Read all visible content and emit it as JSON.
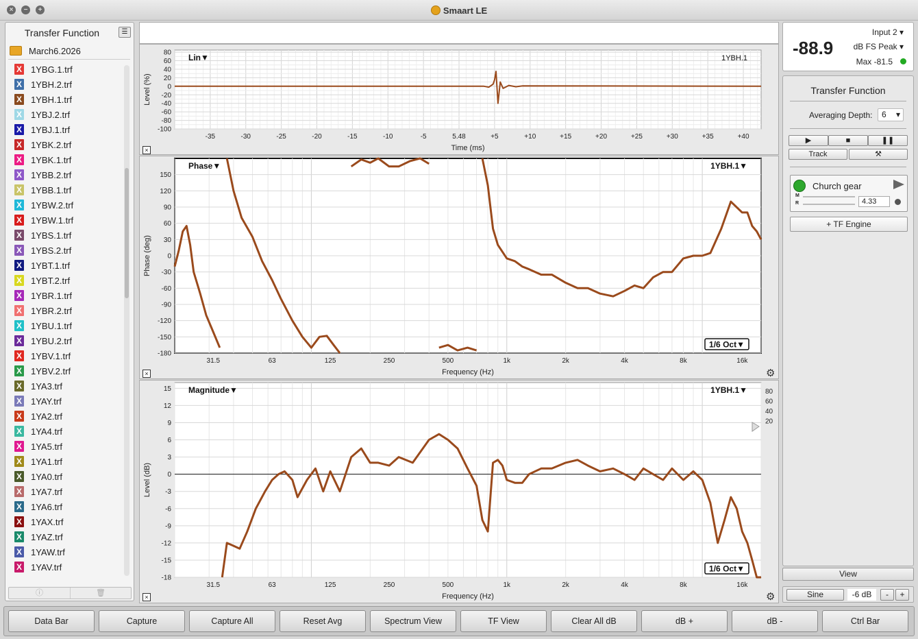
{
  "window": {
    "title": "Smaart LE"
  },
  "sidebar": {
    "title": "Transfer Function",
    "folder": "March6.2026",
    "files": [
      {
        "name": "1YBG.1.trf",
        "color": "#e53935"
      },
      {
        "name": "1YBH.2.trf",
        "color": "#3f6fa8"
      },
      {
        "name": "1YBH.1.trf",
        "color": "#8a4a1e"
      },
      {
        "name": "1YBJ.2.trf",
        "color": "#9fd8e6"
      },
      {
        "name": "1YBJ.1.trf",
        "color": "#1a1aa8"
      },
      {
        "name": "1YBK.2.trf",
        "color": "#c62828"
      },
      {
        "name": "1YBK.1.trf",
        "color": "#ec1c84"
      },
      {
        "name": "1YBB.2.trf",
        "color": "#8e58c8"
      },
      {
        "name": "1YBB.1.trf",
        "color": "#c9c468"
      },
      {
        "name": "1YBW.2.trf",
        "color": "#1fb8d8"
      },
      {
        "name": "1YBW.1.trf",
        "color": "#d81c1c"
      },
      {
        "name": "1YBS.1.trf",
        "color": "#7a4a6a"
      },
      {
        "name": "1YBS.2.trf",
        "color": "#8a58b8"
      },
      {
        "name": "1YBT.1.trf",
        "color": "#101a80"
      },
      {
        "name": "1YBT.2.trf",
        "color": "#d8d820"
      },
      {
        "name": "1YBR.1.trf",
        "color": "#a628b8"
      },
      {
        "name": "1YBR.2.trf",
        "color": "#f07070"
      },
      {
        "name": "1YBU.1.trf",
        "color": "#20c0c8"
      },
      {
        "name": "1YBU.2.trf",
        "color": "#6a2a9a"
      },
      {
        "name": "1YBV.1.trf",
        "color": "#e02820"
      },
      {
        "name": "1YBV.2.trf",
        "color": "#2a9a4a"
      },
      {
        "name": "1YA3.trf",
        "color": "#6a6a2a"
      },
      {
        "name": "1YAY.trf",
        "color": "#7a7ab8"
      },
      {
        "name": "1YA2.trf",
        "color": "#c83a1a"
      },
      {
        "name": "1YA4.trf",
        "color": "#3ab8a0"
      },
      {
        "name": "1YA5.trf",
        "color": "#e01890"
      },
      {
        "name": "1YA1.trf",
        "color": "#a08a1a"
      },
      {
        "name": "1YA0.trf",
        "color": "#4a5a2a"
      },
      {
        "name": "1YA7.trf",
        "color": "#b86a6a"
      },
      {
        "name": "1YA6.trf",
        "color": "#2a6a8a"
      },
      {
        "name": "1YAX.trf",
        "color": "#8a1010"
      },
      {
        "name": "1YAZ.trf",
        "color": "#1a8a6a"
      },
      {
        "name": "1YAW.trf",
        "color": "#4a5aa8"
      },
      {
        "name": "1YAV.trf",
        "color": "#c81a6a"
      }
    ]
  },
  "meter": {
    "value": "-88.9",
    "input": "Input 2",
    "unit": "dB FS Peak",
    "max": "Max -81.5"
  },
  "tf_panel": {
    "title": "Transfer Function",
    "avg_label": "Averaging Depth:",
    "avg_value": "6",
    "track_label": "Track",
    "engine_name": "Church gear",
    "engine_value": "4.33",
    "m_label": "M",
    "r_label": "R",
    "add_engine": "+ TF Engine"
  },
  "view_label": "View",
  "signal": {
    "type": "Sine",
    "level": "-6 dB",
    "minus": "-",
    "plus": "+"
  },
  "bottom_buttons": [
    "Data Bar",
    "Capture",
    "Capture All",
    "Reset Avg",
    "Spectrum View",
    "TF View",
    "Clear All dB",
    "dB +",
    "dB -",
    "Ctrl Bar"
  ],
  "chart_data": [
    {
      "type": "line",
      "title": "Lin▼",
      "trace_label": "1YBH.1",
      "xlabel": "Time (ms)",
      "ylabel": "Level (%)",
      "x_ticks": [
        "-35",
        "-30",
        "-25",
        "-20",
        "-15",
        "-10",
        "-5",
        "5.48",
        "+5",
        "+10",
        "+15",
        "+20",
        "+25",
        "+30",
        "+35",
        "+40"
      ],
      "y_ticks": [
        "80",
        "60",
        "40",
        "20",
        "0",
        "-20",
        "-40",
        "-60",
        "-80",
        "-100"
      ],
      "xlim": [
        -40,
        42.5
      ],
      "ylim": [
        -100,
        85
      ],
      "series": [
        {
          "color": "#9a4a1c",
          "x": [
            -40,
            3.5,
            4.2,
            4.8,
            5.0,
            5.2,
            5.48,
            5.8,
            6.2,
            7.0,
            8.0,
            9.0,
            42.5
          ],
          "y": [
            0,
            0,
            -2,
            5,
            15,
            35,
            -40,
            10,
            -5,
            2,
            -1,
            1,
            0
          ]
        }
      ]
    },
    {
      "type": "line",
      "title": "Phase▼",
      "trace_label": "1YBH.1▼",
      "smoothing": "1/6 Oct▼",
      "xlabel": "Frequency (Hz)",
      "ylabel": "Phase (deg)",
      "x_ticks": [
        "31.5",
        "63",
        "125",
        "250",
        "500",
        "1k",
        "2k",
        "4k",
        "8k",
        "16k"
      ],
      "y_ticks": [
        "150",
        "120",
        "90",
        "60",
        "30",
        "0",
        "-30",
        "-60",
        "-90",
        "-120",
        "-150",
        "-180"
      ],
      "xlim": [
        20,
        20000
      ],
      "ylim": [
        -180,
        180
      ],
      "series": [
        {
          "color": "#9a4a1c",
          "x": [
            20,
            21,
            22,
            23,
            24,
            25,
            27,
            29,
            31,
            34,
            37,
            40,
            44,
            50,
            56,
            63,
            70,
            80,
            90,
            100,
            110,
            120,
            130,
            140,
            160,
            180,
            200,
            220,
            250,
            280,
            320,
            360,
            400,
            450,
            500,
            560,
            630,
            700,
            750,
            800,
            850,
            900,
            1000,
            1100,
            1200,
            1300,
            1500,
            1700,
            2000,
            2300,
            2600,
            3000,
            3500,
            4000,
            4500,
            5000,
            5600,
            6300,
            7000,
            8000,
            9000,
            10000,
            11000,
            12500,
            14000,
            16000,
            17000,
            18000,
            19000,
            20000
          ],
          "y": [
            -20,
            10,
            45,
            55,
            20,
            -30,
            -70,
            -110,
            -135,
            -170,
            180,
            120,
            70,
            35,
            -10,
            -45,
            -80,
            -120,
            -150,
            -170,
            -150,
            -148,
            -165,
            -180,
            165,
            178,
            172,
            185,
            165,
            165,
            175,
            185,
            170,
            -170,
            -165,
            -175,
            -170,
            -175,
            185,
            130,
            50,
            20,
            -5,
            -10,
            -20,
            -25,
            -35,
            -35,
            -50,
            -60,
            -60,
            -70,
            -75,
            -65,
            -55,
            -60,
            -40,
            -30,
            -30,
            -5,
            0,
            0,
            5,
            50,
            100,
            80,
            80,
            55,
            45,
            30
          ]
        }
      ]
    },
    {
      "type": "line",
      "title": "Magnitude▼",
      "trace_label": "1YBH.1▼",
      "smoothing": "1/6 Oct▼",
      "xlabel": "Frequency (Hz)",
      "ylabel": "Level (dB)",
      "x_ticks": [
        "31.5",
        "63",
        "125",
        "250",
        "500",
        "1k",
        "2k",
        "4k",
        "8k",
        "16k"
      ],
      "y_ticks": [
        "15",
        "12",
        "9",
        "6",
        "3",
        "0",
        "-3",
        "-6",
        "-9",
        "-12",
        "-15",
        "-18"
      ],
      "y2_ticks": [
        "80",
        "60",
        "40",
        "20"
      ],
      "xlim": [
        20,
        20000
      ],
      "ylim": [
        -18,
        16
      ],
      "series": [
        {
          "color": "#9a4a1c",
          "x": [
            35,
            37,
            40,
            43,
            47,
            52,
            58,
            63,
            68,
            73,
            80,
            85,
            95,
            105,
            115,
            125,
            140,
            160,
            180,
            200,
            220,
            250,
            280,
            330,
            400,
            450,
            500,
            560,
            630,
            700,
            750,
            800,
            850,
            900,
            950,
            1000,
            1100,
            1200,
            1300,
            1500,
            1700,
            2000,
            2300,
            2600,
            3000,
            3500,
            4000,
            4500,
            5000,
            5600,
            6300,
            7000,
            8000,
            9000,
            10000,
            11000,
            12000,
            13000,
            14000,
            15000,
            16000,
            17000,
            18000,
            19000,
            20000
          ],
          "y": [
            -18,
            -12,
            -12.5,
            -13,
            -10,
            -6,
            -3,
            -1,
            0,
            0.5,
            -1,
            -4,
            -1,
            1,
            -3,
            0.5,
            -3,
            3,
            4.5,
            2,
            2,
            1.5,
            3,
            2,
            6,
            7,
            6,
            4.5,
            1,
            -2,
            -8,
            -10,
            2,
            2.5,
            1.5,
            -1,
            -1.5,
            -1.5,
            0,
            1,
            1,
            2,
            2.5,
            1.5,
            0.5,
            1,
            0,
            -1,
            1,
            0,
            -1,
            1,
            -1,
            0.5,
            -1,
            -5,
            -12,
            -8,
            -4,
            -6,
            -10,
            -12,
            -15,
            -18,
            -18
          ]
        }
      ]
    }
  ]
}
